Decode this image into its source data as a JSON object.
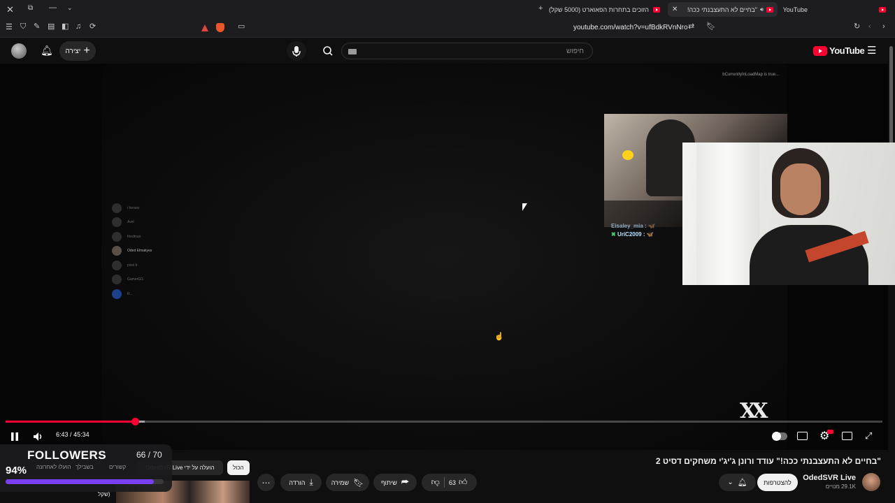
{
  "browser": {
    "tabs": [
      {
        "label": "YouTube"
      },
      {
        "label": "\"בחיים לא התעצבנתי ככה!\" ע"
      },
      {
        "label": "הזוכים בתחרות הפאוארט (5000 שקל)"
      }
    ],
    "url": "youtube.com/watch?v=ufBdkRVnNro"
  },
  "yt": {
    "logo_text": "YouTube",
    "search_placeholder": "חיפוש",
    "create_label": "יצירה"
  },
  "player": {
    "overlay_debug": "bCurrentlyInLoadMap is true...",
    "time_current": "6:43",
    "time_total": "45:34",
    "time_display": "6:43 / 45:34",
    "progress_fraction": 0.1474,
    "chat_names": [
      "i hersev",
      "Avel",
      "friedman",
      "Oded Elmakyes",
      "pixel b",
      "GamerGG",
      "R..."
    ],
    "cam_chat": [
      {
        "user": "Eisaley_mia :",
        "msg": "🦋"
      },
      {
        "user": "UriC2009 :",
        "msg": "🦋"
      }
    ]
  },
  "video": {
    "title": "\"בחיים לא התעצבנתי ככה!\" עודד ורונן ג'יג'י משחקים דסיט 2",
    "channel_name": "OdedSVR Live",
    "subscribers": "29.1K מנויים",
    "join_label": "להצטרפות",
    "like_count": "63",
    "share_label": "שיתוף",
    "save_label": "שמירה",
    "download_label": "הורדה"
  },
  "chips": {
    "all_label": "הכול",
    "uploaded_by": "הועלה על ידי OdedSVR Live",
    "related": "קשורים",
    "for_you": "בשבילך",
    "recently": "הועלו לאחרונה"
  },
  "followers_widget": {
    "label": "FOLLOWERS",
    "count": "66 / 70",
    "percent": "94%",
    "fraction": 0.94
  },
  "recommendation": {
    "text": "שקל)"
  },
  "colors": {
    "accent_red": "#ff0033",
    "followers_bar": "#7b3ff2"
  }
}
